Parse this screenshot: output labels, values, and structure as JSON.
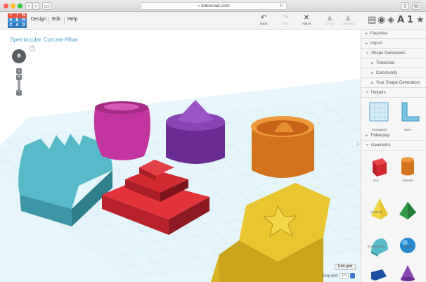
{
  "browser": {
    "url": "tinkercad.com"
  },
  "app": {
    "logo_letters": [
      "T",
      "I",
      "N",
      "K",
      "E",
      "R",
      "C",
      "A",
      "D"
    ],
    "menus": [
      "Design",
      "Edit",
      "Help"
    ],
    "tools": [
      {
        "label": "Undo",
        "icon": "undo-icon",
        "enabled": true
      },
      {
        "label": "Redo",
        "icon": "redo-icon",
        "enabled": false
      },
      {
        "label": "Adjust",
        "icon": "adjust-icon",
        "enabled": true
      },
      {
        "label": "Group",
        "icon": "group-icon",
        "enabled": false
      },
      {
        "label": "Ungroup",
        "icon": "ungroup-icon",
        "enabled": false
      }
    ],
    "view_icons": [
      "notes-icon",
      "solid-icon",
      "box-icon",
      "text-icon",
      "number-icon",
      "star-icon"
    ]
  },
  "workplane": {
    "title": "Spectacular Curcan-Albar",
    "help": "?",
    "edit_grid_label": "Edit grid",
    "snap_label": "Snap grid:",
    "snap_value": "1.0"
  },
  "panel": {
    "favorites": "Favorites",
    "import": "Import",
    "shape_generators": "Shape Generators",
    "generators": [
      "Tinkercad",
      "Community",
      "Your Shape Generators"
    ],
    "helpers": "Helpers",
    "helper_items": [
      "Workplane",
      "Ruler"
    ],
    "tinkerplay": "Tinkerplay",
    "geometric": "Geometric",
    "shapes": [
      "Box",
      "Cylinder",
      "Pyramid",
      "Roof",
      "Round Roof",
      "Sphere",
      "",
      "Cone"
    ]
  },
  "colors": {
    "accent": "#4aa3c9",
    "grid": "#bfe3f0"
  }
}
